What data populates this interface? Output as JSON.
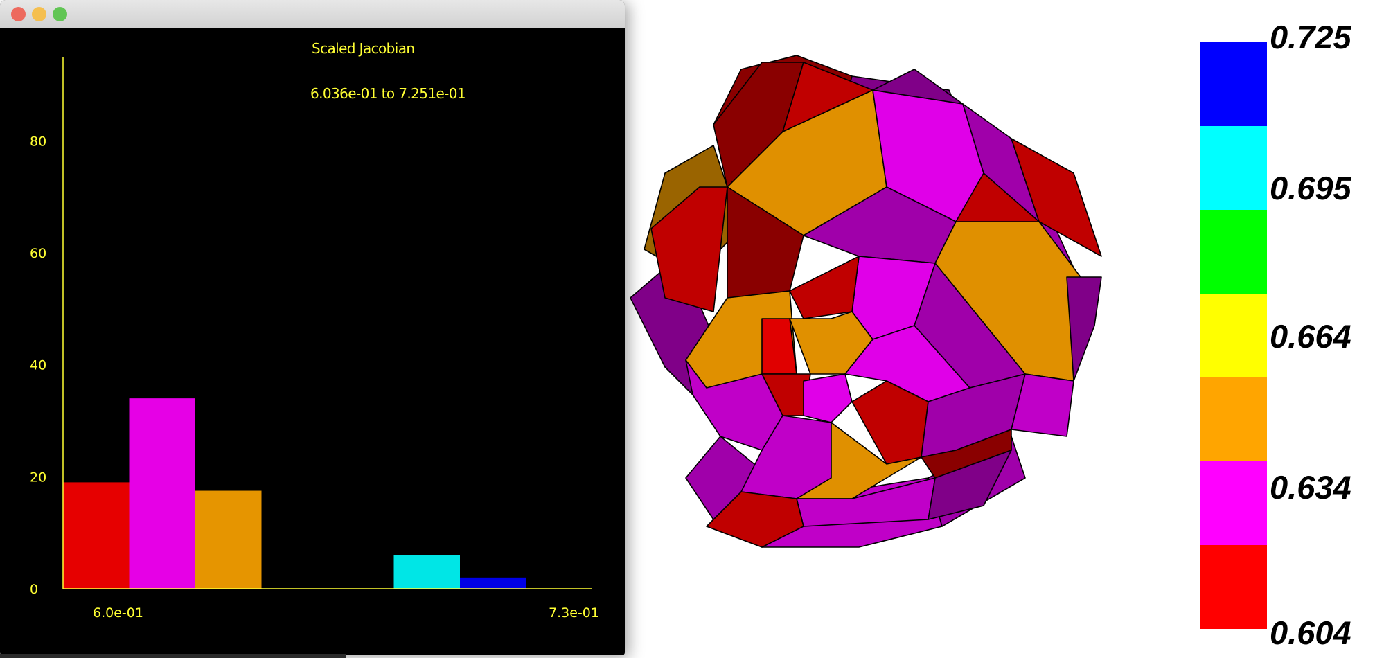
{
  "window": {
    "traffic_lights": [
      "close",
      "minimize",
      "zoom"
    ],
    "histogram": {
      "title": "Scaled Jacobian",
      "range_text": "6.036e-01 to 7.251e-01"
    }
  },
  "chart_data": {
    "type": "bar",
    "title": "Scaled Jacobian",
    "subtitle": "6.036e-01 to 7.251e-01",
    "y_ticks": [
      "80",
      "60",
      "40",
      "20",
      "0"
    ],
    "x_tick_labels": [
      "6.0e-01",
      "7.3e-01"
    ],
    "ylim": [
      0,
      95
    ],
    "bins": 8,
    "values": [
      19,
      34,
      17.5,
      0,
      0,
      6,
      2,
      0
    ],
    "bar_colors": [
      "#e60000",
      "#e600e6",
      "#e69500",
      "#ffff00",
      "#00e600",
      "#00e6e6",
      "#0000e6",
      "#000000"
    ],
    "axis_color": "#ffff33",
    "grid": false
  },
  "legend": {
    "labels": [
      "0.725",
      "0.695",
      "0.664",
      "0.634",
      "0.604"
    ],
    "colors": [
      "#0000ff",
      "#00ffff",
      "#00ff00",
      "#ffff00",
      "#ffa500",
      "#ff00ff",
      "#ff0000"
    ]
  },
  "mesh": {
    "face_colors": {
      "magenta": "#e000e8",
      "purple": "#a000aa",
      "dark_purple": "#800088",
      "red": "#c00000",
      "dark_red": "#8a0000",
      "orange": "#e09000",
      "dark_orange": "#9a6400",
      "edge": "#000000"
    }
  }
}
